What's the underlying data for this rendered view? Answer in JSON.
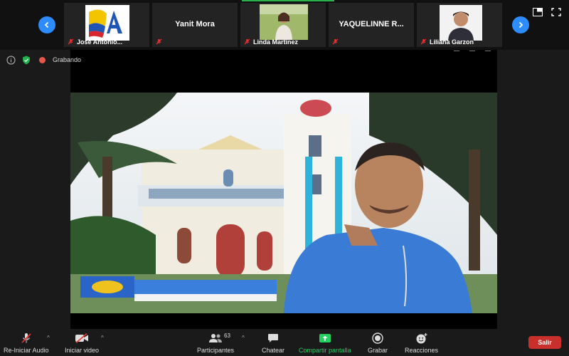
{
  "meeting": {
    "recording_label": "Grabando"
  },
  "participants_strip": [
    {
      "name": "Jose Antonio...",
      "has_video": true,
      "muted": true
    },
    {
      "name": "Yanit Mora",
      "has_video": false,
      "muted": true
    },
    {
      "name": "Linda Martinez",
      "has_video": true,
      "muted": true
    },
    {
      "name": "YAQUELINNE R...",
      "has_video": false,
      "muted": true
    },
    {
      "name": "Liliana Garzon",
      "has_video": true,
      "muted": true
    }
  ],
  "toolbar": {
    "audio_label": "Re-Iniciar Audio",
    "video_label": "Iniciar video",
    "participants_label": "Participantes",
    "participants_count": "63",
    "chat_label": "Chatear",
    "share_label": "Compartir pantalla",
    "record_label": "Grabar",
    "reactions_label": "Reacciones",
    "leave_label": "Salir"
  },
  "colors": {
    "accent_blue": "#2d8cff",
    "share_green": "#23d160",
    "leave_red": "#c9302c",
    "recording_red": "#e8584a"
  }
}
